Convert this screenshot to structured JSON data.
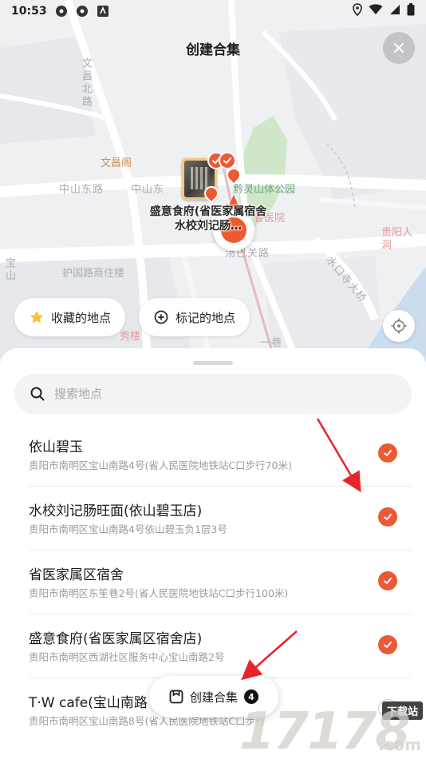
{
  "status_bar": {
    "time": "10:53"
  },
  "header": {
    "title": "创建合集"
  },
  "map": {
    "road_labels": [
      "文昌北路",
      "中山东路",
      "中山东",
      "汤巴关路",
      "护国路商住楼",
      "水口寺大桥",
      "一巷",
      "宝山"
    ],
    "poi_labels": [
      "文昌阁",
      "黔灵山体公园",
      "省医院",
      "贵阳人洞",
      "秀楼"
    ],
    "cluster_label_line1": "盛意食府(省医家属宿舍",
    "cluster_label_line2": "水校刘记肠…"
  },
  "chips": {
    "favorites": "收藏的地点",
    "marked": "标记的地点"
  },
  "search": {
    "placeholder": "搜索地点"
  },
  "places": [
    {
      "name": "依山碧玉",
      "address": "贵阳市南明区宝山南路4号(省人民医院地铁站C口步行70米)",
      "checked": true
    },
    {
      "name": "水校刘记肠旺面(依山碧玉店)",
      "address": "贵阳市南明区宝山南路4号依山碧玉负1层3号",
      "checked": true
    },
    {
      "name": "省医家属区宿舍",
      "address": "贵阳市南明区东笙巷2号(省人民医院地铁站C口步行100米)",
      "checked": true
    },
    {
      "name": "盛意食府(省医家属区宿舍店)",
      "address": "贵阳市南明区西湖社区服务中心宝山南路2号",
      "checked": true
    },
    {
      "name": "T·W cafe(宝山南路",
      "address": "贵阳市南明区宝山南路8号(省人民医院地铁站C口步行",
      "checked": false
    }
  ],
  "create_button": {
    "label": "创建合集",
    "count": "4"
  },
  "watermark": {
    "number": "17178",
    "domain": ".com",
    "tag": "下载站"
  },
  "colors": {
    "accent": "#ea5a35",
    "annotation_arrow": "#e8232a"
  }
}
